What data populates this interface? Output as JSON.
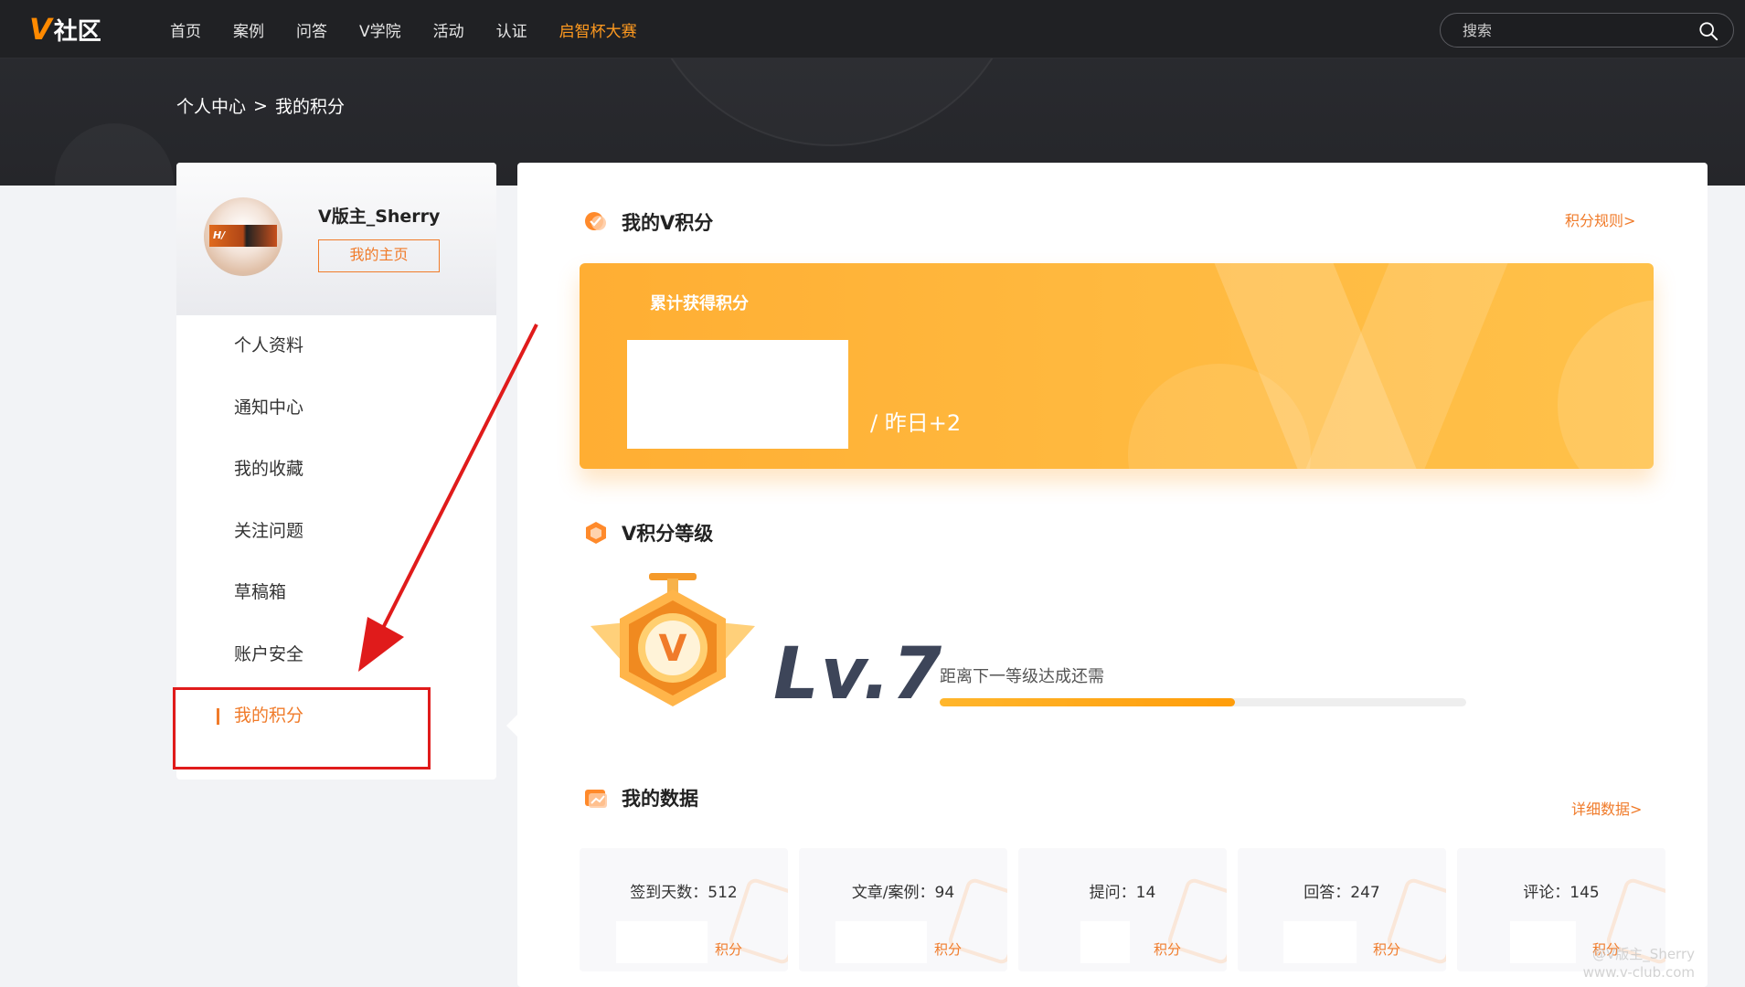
{
  "header": {
    "logo_v": "V",
    "logo_text": "社区",
    "nav": [
      {
        "label": "首页"
      },
      {
        "label": "案例"
      },
      {
        "label": "问答"
      },
      {
        "label": "V学院"
      },
      {
        "label": "活动"
      },
      {
        "label": "认证"
      },
      {
        "label": "启智杯大赛",
        "active": true
      }
    ],
    "search_placeholder": "搜索"
  },
  "breadcrumb": {
    "parent": "个人中心",
    "separator": ">",
    "current": "我的积分"
  },
  "profile": {
    "username": "V版主_Sherry",
    "home_button": "我的主页"
  },
  "sidebar": {
    "items": [
      {
        "label": "个人资料"
      },
      {
        "label": "通知中心"
      },
      {
        "label": "我的收藏"
      },
      {
        "label": "关注问题"
      },
      {
        "label": "草稿箱"
      },
      {
        "label": "账户安全"
      },
      {
        "label": "我的积分",
        "active": true
      }
    ]
  },
  "points": {
    "title": "我的V积分",
    "rules_link": "积分规则>",
    "card_label": "累计获得积分",
    "yesterday": "/ 昨日+2"
  },
  "level": {
    "title": "V积分等级",
    "level_text": "Lv.7",
    "next_label": "距离下一等级达成还需",
    "progress": 0.56
  },
  "mydata": {
    "title": "我的数据",
    "detail_link": "详细数据>",
    "stats": [
      {
        "label": "签到天数：512",
        "unit": "积分"
      },
      {
        "label": "文章/案例：94",
        "unit": "积分"
      },
      {
        "label": "提问：14",
        "unit": "积分"
      },
      {
        "label": "回答：247",
        "unit": "积分"
      },
      {
        "label": "评论：145",
        "unit": "积分"
      }
    ]
  },
  "watermark": {
    "line1": "@V版主_Sherry",
    "line2": "www.v-club.com"
  },
  "colors": {
    "accent": "#f07b2a",
    "header_bg": "#202124",
    "annotation_red": "#e01b1b"
  }
}
